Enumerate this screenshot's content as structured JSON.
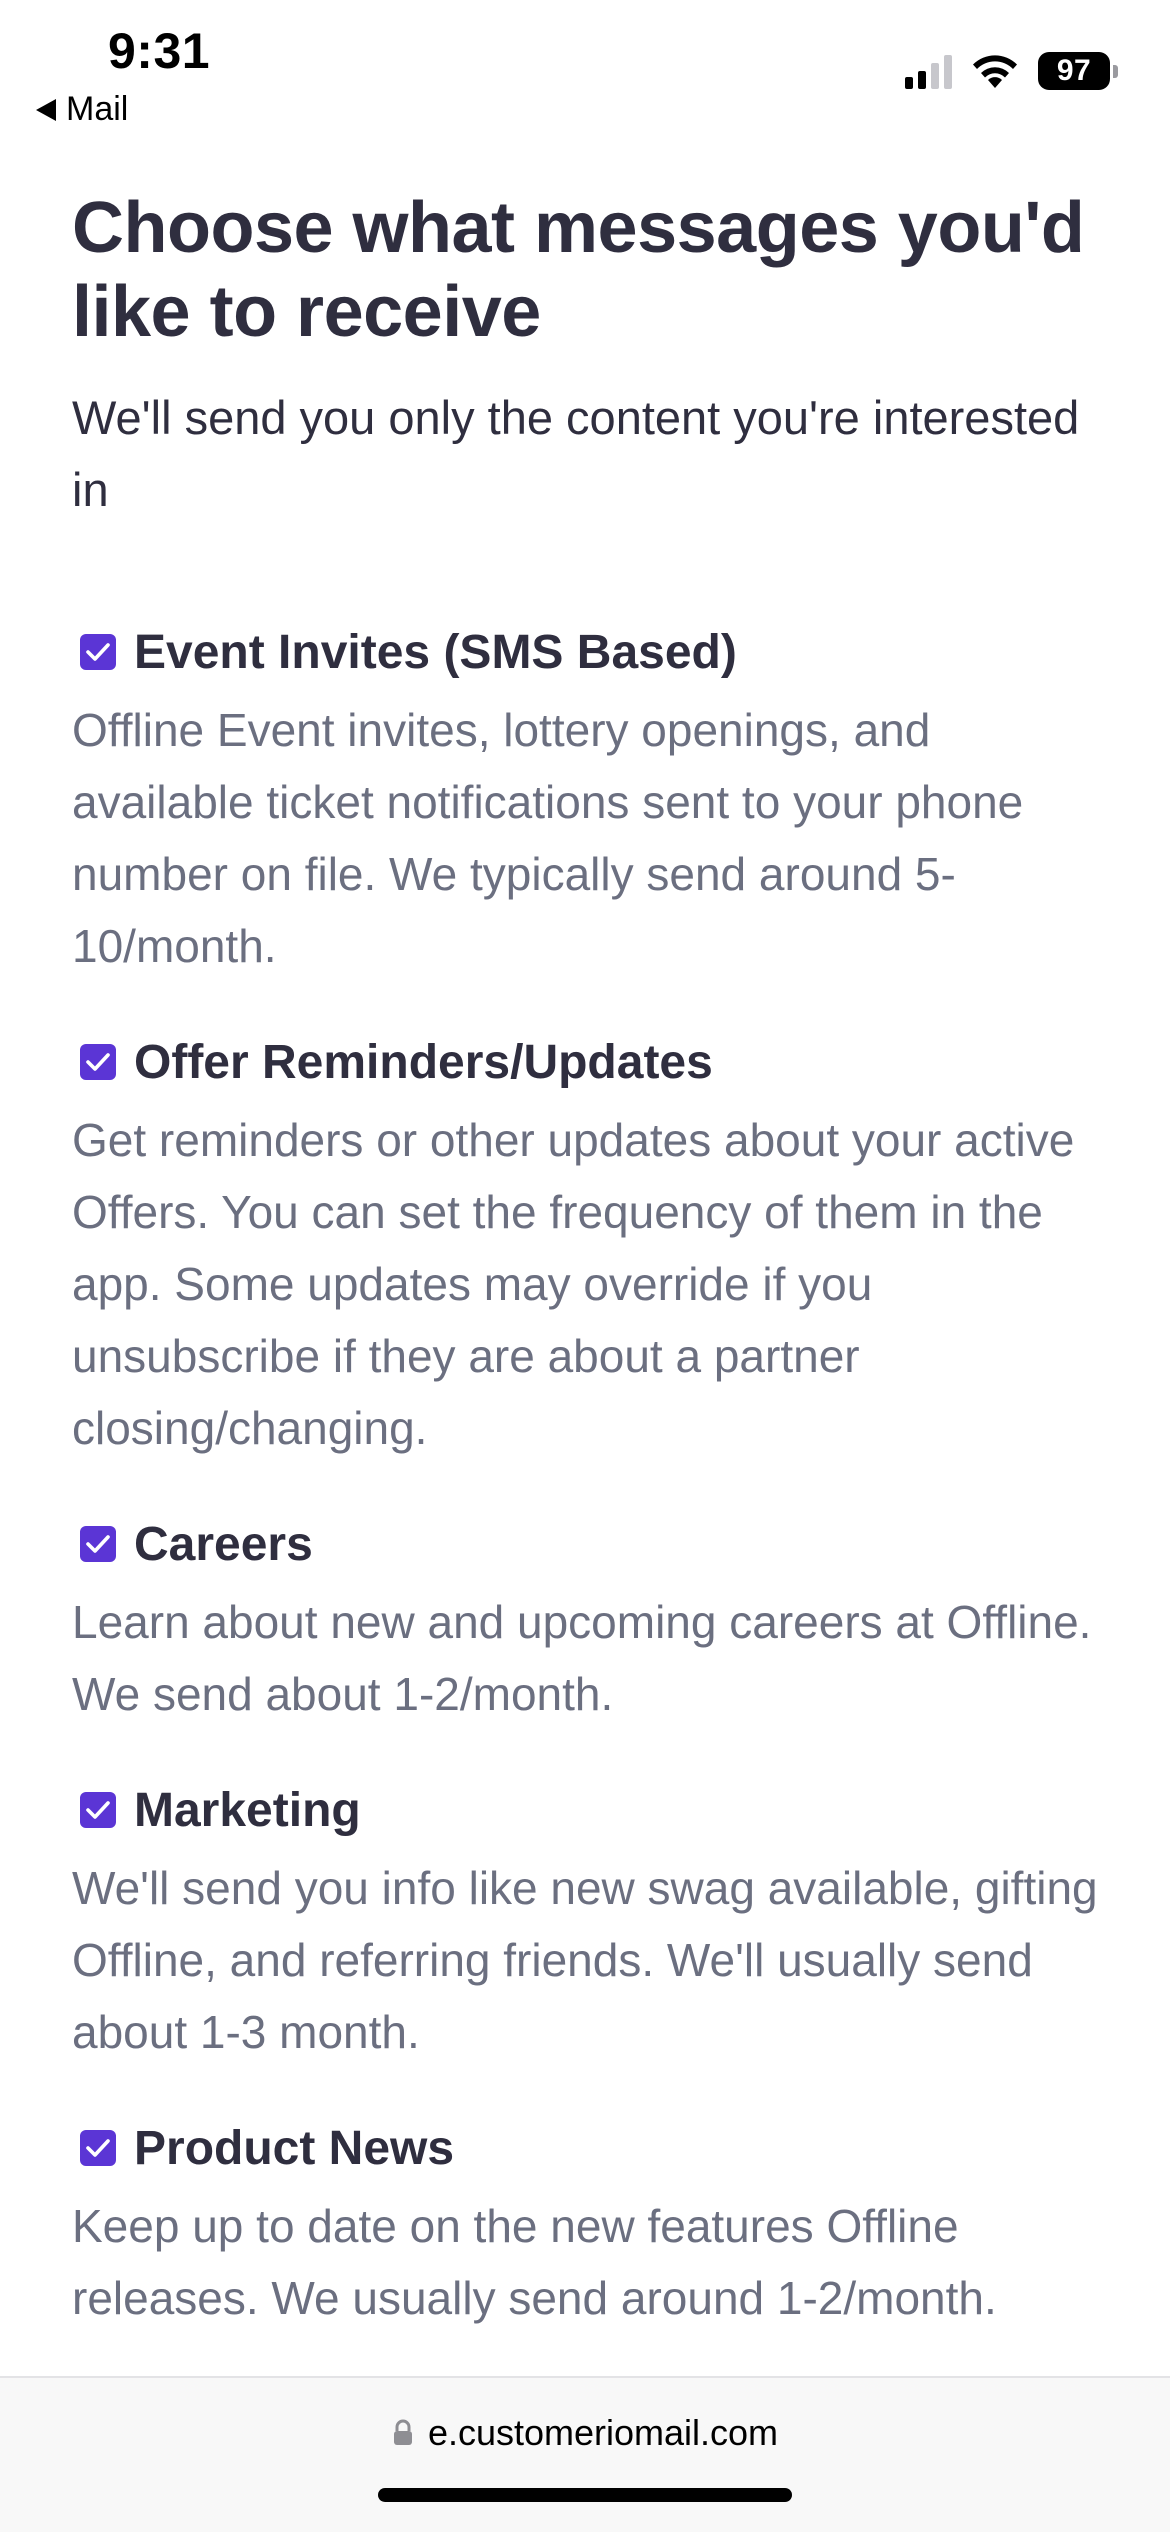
{
  "status_bar": {
    "time": "9:31",
    "back_app_label": "Mail",
    "battery_level": "97",
    "signal_bars_active": 2,
    "signal_bars_total": 4
  },
  "page": {
    "title": "Choose what messages you'd like to receive",
    "subtitle": "We'll send you only the content you're interested in"
  },
  "preferences": [
    {
      "title": "Event Invites (SMS Based)",
      "description": "Offline Event invites, lottery openings, and available ticket notifications sent to your phone number on file. We typically send around 5-10/month.",
      "checked": true
    },
    {
      "title": "Offer Reminders/Updates",
      "description": "Get reminders or other updates about your active Offers. You can set the frequency of them in the app. Some updates may override if you unsubscribe if they are about a partner closing/changing.",
      "checked": true
    },
    {
      "title": "Careers",
      "description": "Learn about new and upcoming careers at Offline. We send about 1-2/month.",
      "checked": true
    },
    {
      "title": "Marketing",
      "description": "We'll send you info like new swag available, gifting Offline, and referring friends. We'll usually send about 1-3 month.",
      "checked": true
    },
    {
      "title": "Product News",
      "description": "Keep up to date on the new features Offline releases. We usually send around 1-2/month.",
      "checked": true
    }
  ],
  "browser": {
    "url": "e.customeriomail.com",
    "lock_icon": "lock-icon"
  },
  "colors": {
    "accent": "#5b35d5",
    "heading": "#2f2e3f",
    "body_muted": "#6b6f80",
    "url_bar_bg": "#f8f8f8"
  }
}
